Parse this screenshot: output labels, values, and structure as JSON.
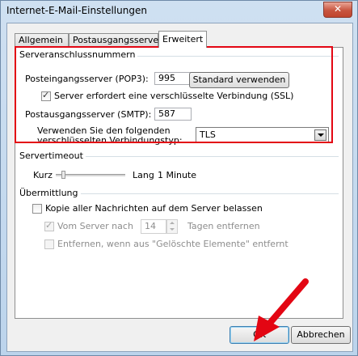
{
  "window": {
    "title": "Internet-E-Mail-Einstellungen",
    "close_symbol": "✕"
  },
  "tabs": [
    {
      "label": "Allgemein"
    },
    {
      "label": "Postausgangsserver"
    },
    {
      "label": "Erweitert"
    }
  ],
  "server_ports": {
    "group_title": "Serveranschlussnummern",
    "pop3_label": "Posteingangsserver (POP3):",
    "pop3_value": "995",
    "default_button": "Standard verwenden",
    "ssl_label": "Server erfordert eine verschlüsselte Verbindung (SSL)",
    "smtp_label": "Postausgangsserver (SMTP):",
    "smtp_value": "587",
    "enc_label_line1": "Verwenden Sie den folgenden",
    "enc_label_line2": "verschlüsselten Verbindungstyp:",
    "enc_value": "TLS"
  },
  "timeout": {
    "group_title": "Servertimeout",
    "short_label": "Kurz",
    "long_label": "Lang",
    "value_text": "1 Minute"
  },
  "delivery": {
    "group_title": "Übermittlung",
    "keep_copy_label": "Kopie aller Nachrichten auf dem Server belassen",
    "remove_after_label": "Vom Server nach",
    "days_value": "14",
    "days_suffix": "Tagen entfernen",
    "remove_deleted_label": "Entfernen, wenn aus \"Gelöschte Elemente\" entfernt"
  },
  "footer": {
    "ok_label": "OK",
    "cancel_label": "Abbrechen"
  },
  "colors": {
    "highlight_red": "#e30613"
  }
}
